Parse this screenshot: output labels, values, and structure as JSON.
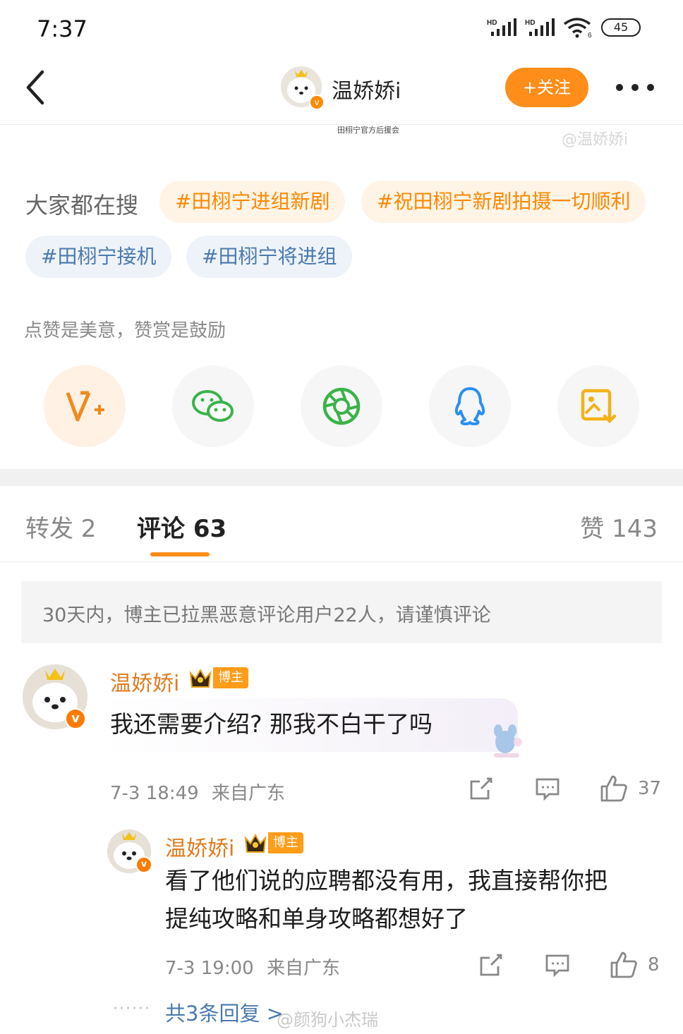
{
  "status_bar": {
    "time": "7:37",
    "signal1": "HD",
    "signal2": "HD",
    "wifi_sub": "6",
    "battery": "45"
  },
  "header": {
    "username": "温娇娇i",
    "follow_label": "+关注"
  },
  "cut_text": "田栩宁官方后援会",
  "watermark_top": "@温娇娇i",
  "search": {
    "label": "大家都在搜",
    "tags": [
      "#田栩宁进组新剧",
      "#祝田栩宁新剧拍摄一切顺利",
      "#田栩宁接机",
      "#田栩宁将进组"
    ]
  },
  "reward": {
    "text": "点赞是美意，赞赏是鼓励"
  },
  "share_icons": [
    "v-plus-icon",
    "wechat-icon",
    "moments-icon",
    "qq-icon",
    "save-image-icon"
  ],
  "tabs": {
    "repost": "转发 2",
    "comment": "评论 63",
    "like": "赞 143"
  },
  "notice": "30天内，博主已拉黑恶意评论用户22人，请谨慎评论",
  "comment": {
    "name": "温娇娇i",
    "badge": "博主",
    "verify": "v",
    "text": "我还需要介绍? 那我不白干了吗",
    "time": "7-3 18:49",
    "location": "来自广东",
    "likes": "37"
  },
  "reply": {
    "name": "温娇娇i",
    "badge": "博主",
    "verify": "v",
    "text_line1": "看了他们说的应聘都没有用，我直接帮你把",
    "text_line2": "提纯攻略和单身攻略都想好了",
    "time": "7-3 19:00",
    "location": "来自广东",
    "likes": "8"
  },
  "more_replies": {
    "dots": "······",
    "text": "共3条回复 >"
  },
  "watermark_bottom": "@颜狗小杰瑞",
  "colors": {
    "accent": "#ff8d1a",
    "tag_orange": "#ff8800",
    "tag_blue": "#4a7aae",
    "name_orange": "#e07b1f"
  }
}
